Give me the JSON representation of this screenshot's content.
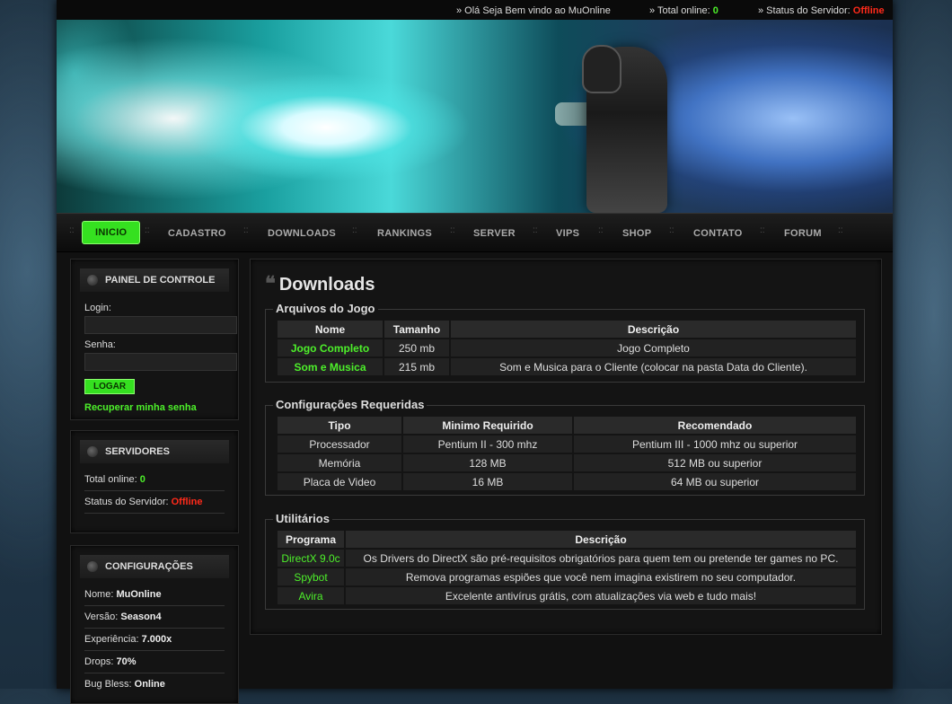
{
  "topbar": {
    "greeting": "» Olá Seja Bem vindo ao MuOnline",
    "online_label": "» Total online:",
    "online_value": "0",
    "status_label": "» Status do Servidor:",
    "status_value": "Offline"
  },
  "nav": [
    "INICIO",
    "CADASTRO",
    "DOWNLOADS",
    "RANKINGS",
    "SERVER",
    "VIPS",
    "SHOP",
    "CONTATO",
    "FORUM"
  ],
  "nav_sep": "::",
  "sidebar": {
    "panel": {
      "title": "PAINEL DE CONTROLE",
      "login_label": "Login:",
      "senha_label": "Senha:",
      "button": "LOGAR",
      "recover": "Recuperar minha senha"
    },
    "servers": {
      "title": "SERVIDORES",
      "online_label": "Total online:",
      "online_value": "0",
      "status_label": "Status do Servidor:",
      "status_value": "Offline"
    },
    "config": {
      "title": "CONFIGURAÇÕES",
      "rows": [
        {
          "label": "Nome:",
          "value": "MuOnline"
        },
        {
          "label": "Versão:",
          "value": "Season4"
        },
        {
          "label": "Experiência:",
          "value": "7.000x"
        },
        {
          "label": "Drops:",
          "value": "70%"
        },
        {
          "label": "Bug Bless:",
          "value": "Online"
        }
      ]
    }
  },
  "main": {
    "title": "Downloads",
    "files": {
      "legend": "Arquivos do Jogo",
      "headers": [
        "Nome",
        "Tamanho",
        "Descrição"
      ],
      "rows": [
        [
          "Jogo Completo",
          "250 mb",
          "Jogo Completo"
        ],
        [
          "Som e Musica",
          "215 mb",
          "Som e Musica para o Cliente (colocar na pasta Data do Cliente)."
        ]
      ]
    },
    "reqs": {
      "legend": "Configurações Requeridas",
      "headers": [
        "Tipo",
        "Minimo Requirido",
        "Recomendado"
      ],
      "rows": [
        [
          "Processador",
          "Pentium II - 300 mhz",
          "Pentium III - 1000 mhz ou superior"
        ],
        [
          "Memória",
          "128 MB",
          "512 MB ou superior"
        ],
        [
          "Placa de Video",
          "16 MB",
          "64 MB ou superior"
        ]
      ]
    },
    "utils": {
      "legend": "Utilitários",
      "headers": [
        "Programa",
        "Descrição"
      ],
      "rows": [
        [
          "DirectX 9.0c",
          "Os Drivers do DirectX são pré-requisitos obrigatórios para quem tem ou pretende ter games no PC."
        ],
        [
          "Spybot",
          "Remova programas espiões que você nem imagina existirem no seu computador."
        ],
        [
          "Avira",
          "Excelente antivírus grátis, com atualizações via web e tudo mais!"
        ]
      ]
    }
  }
}
